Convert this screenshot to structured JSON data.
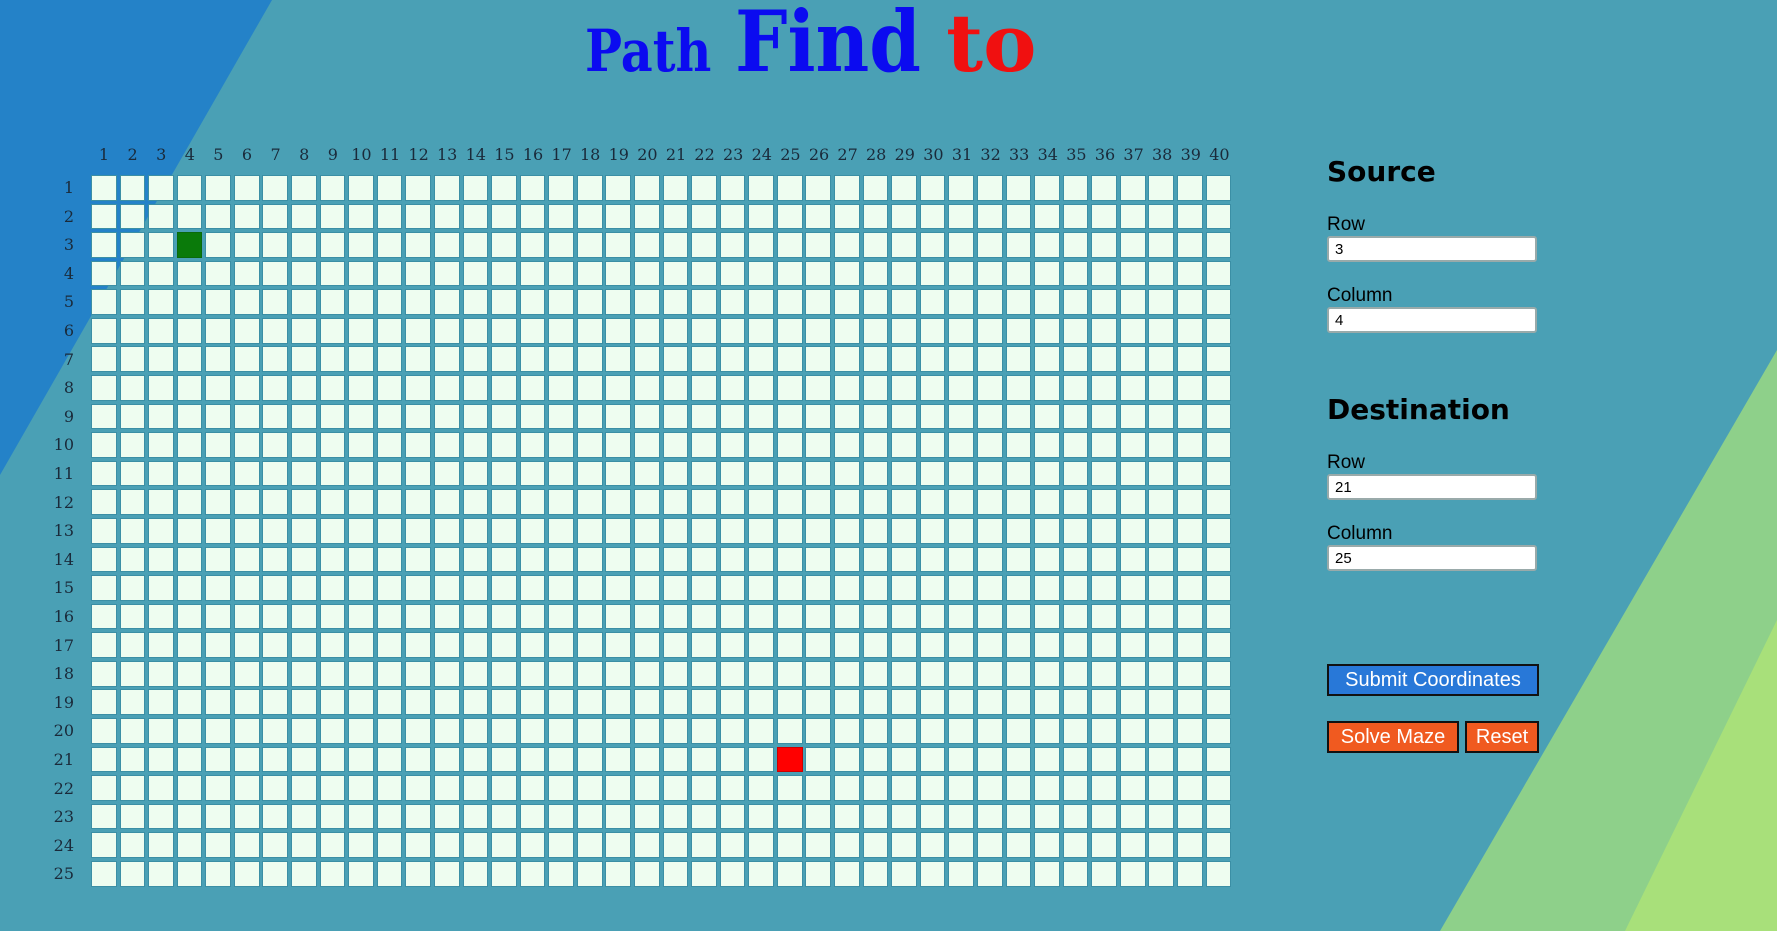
{
  "title": {
    "word1": "Path",
    "word2": "Find",
    "word3": "to"
  },
  "colors": {
    "background": "#4aa0b5",
    "cell": "#eefdf0",
    "source_cell": "#0a7a0a",
    "dest_cell": "#ff0000",
    "button_blue": "#2878d8",
    "button_orange": "#f05a20"
  },
  "grid": {
    "rows": 25,
    "columns": 40,
    "column_labels": [
      "1",
      "2",
      "3",
      "4",
      "5",
      "6",
      "7",
      "8",
      "9",
      "10",
      "11",
      "12",
      "13",
      "14",
      "15",
      "16",
      "17",
      "18",
      "19",
      "20",
      "21",
      "22",
      "23",
      "24",
      "25",
      "26",
      "27",
      "28",
      "29",
      "30",
      "31",
      "32",
      "33",
      "34",
      "35",
      "36",
      "37",
      "38",
      "39",
      "40"
    ],
    "row_labels": [
      "1",
      "2",
      "3",
      "4",
      "5",
      "6",
      "7",
      "8",
      "9",
      "10",
      "11",
      "12",
      "13",
      "14",
      "15",
      "16",
      "17",
      "18",
      "19",
      "20",
      "21",
      "22",
      "23",
      "24",
      "25"
    ],
    "source_cell": {
      "row": 3,
      "column": 4
    },
    "destination_cell": {
      "row": 21,
      "column": 25
    }
  },
  "source": {
    "heading": "Source",
    "row_label": "Row",
    "row_value": "3",
    "column_label": "Column",
    "column_value": "4"
  },
  "destination": {
    "heading": "Destination",
    "row_label": "Row",
    "row_value": "21",
    "column_label": "Column",
    "column_value": "25"
  },
  "buttons": {
    "submit": "Submit Coordinates",
    "solve": "Solve Maze",
    "reset": "Reset"
  }
}
